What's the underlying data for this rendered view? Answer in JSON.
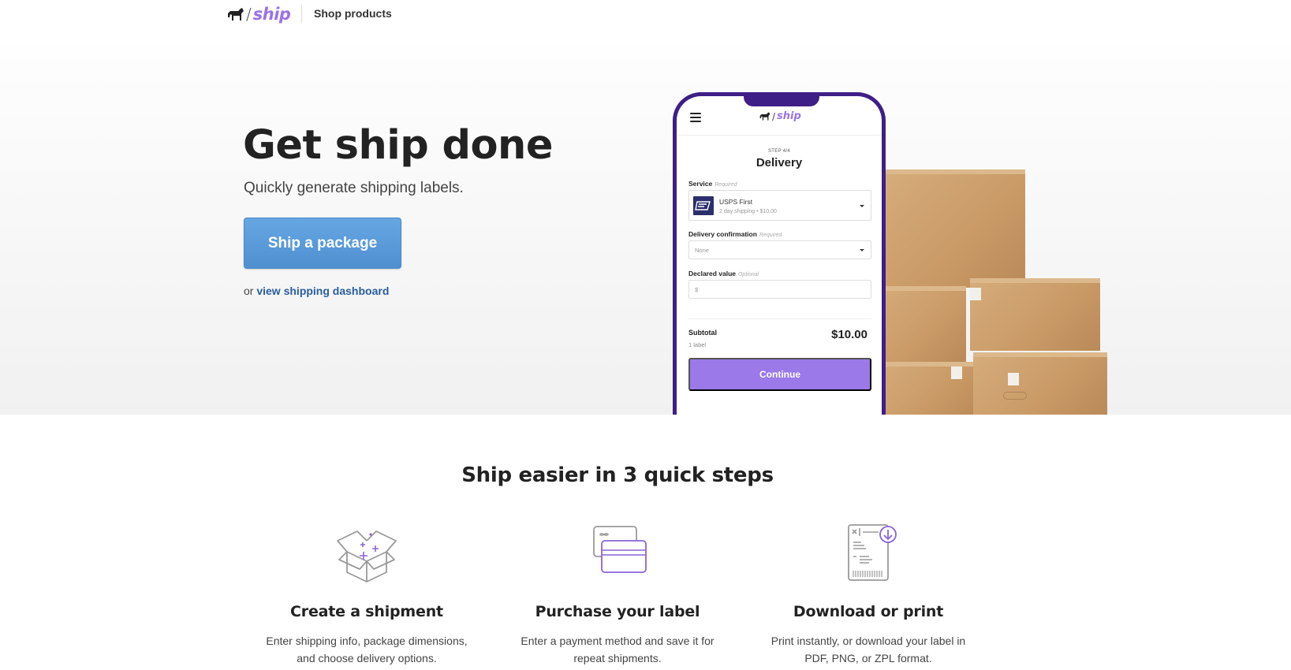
{
  "nav": {
    "logo_slash": "/",
    "logo_text": "ship",
    "link": "Shop products"
  },
  "hero": {
    "title": "Get ship done",
    "subtitle": "Quickly generate shipping labels.",
    "cta": "Ship a package",
    "alt_prefix": "or",
    "alt_link": "view shipping dashboard"
  },
  "phone": {
    "logo_slash": "/",
    "logo_text": "ship",
    "step": "STEP 4/4",
    "title": "Delivery",
    "service": {
      "label": "Service",
      "hint": "Required",
      "name": "USPS First",
      "desc": "2 day shipping • $10,00"
    },
    "confirmation": {
      "label": "Delivery confirmation",
      "hint": "Required",
      "value": "None"
    },
    "declared": {
      "label": "Declared value",
      "hint": "Optional",
      "placeholder": "$"
    },
    "subtotal_label": "Subtotal",
    "subtotal_count": "1 label",
    "subtotal_amount": "$10.00",
    "continue": "Continue"
  },
  "steps": {
    "title": "Ship easier in 3 quick steps",
    "items": [
      {
        "icon": "open-box-icon",
        "title": "Create a shipment",
        "desc": "Enter shipping info, package dimensions, and choose delivery options."
      },
      {
        "icon": "credit-cards-icon",
        "title": "Purchase your label",
        "desc": "Enter a payment method and save it for repeat shipments."
      },
      {
        "icon": "label-download-icon",
        "title": "Download or print",
        "desc": "Print instantly, or download your label in PDF, PNG, or ZPL format."
      }
    ]
  },
  "colors": {
    "brand_purple": "#9b72e6",
    "phone_frame": "#3e1f86",
    "cta_blue": "#5b9bdb",
    "link_blue": "#2a5d9f",
    "continue_purple": "#9b79e8"
  }
}
